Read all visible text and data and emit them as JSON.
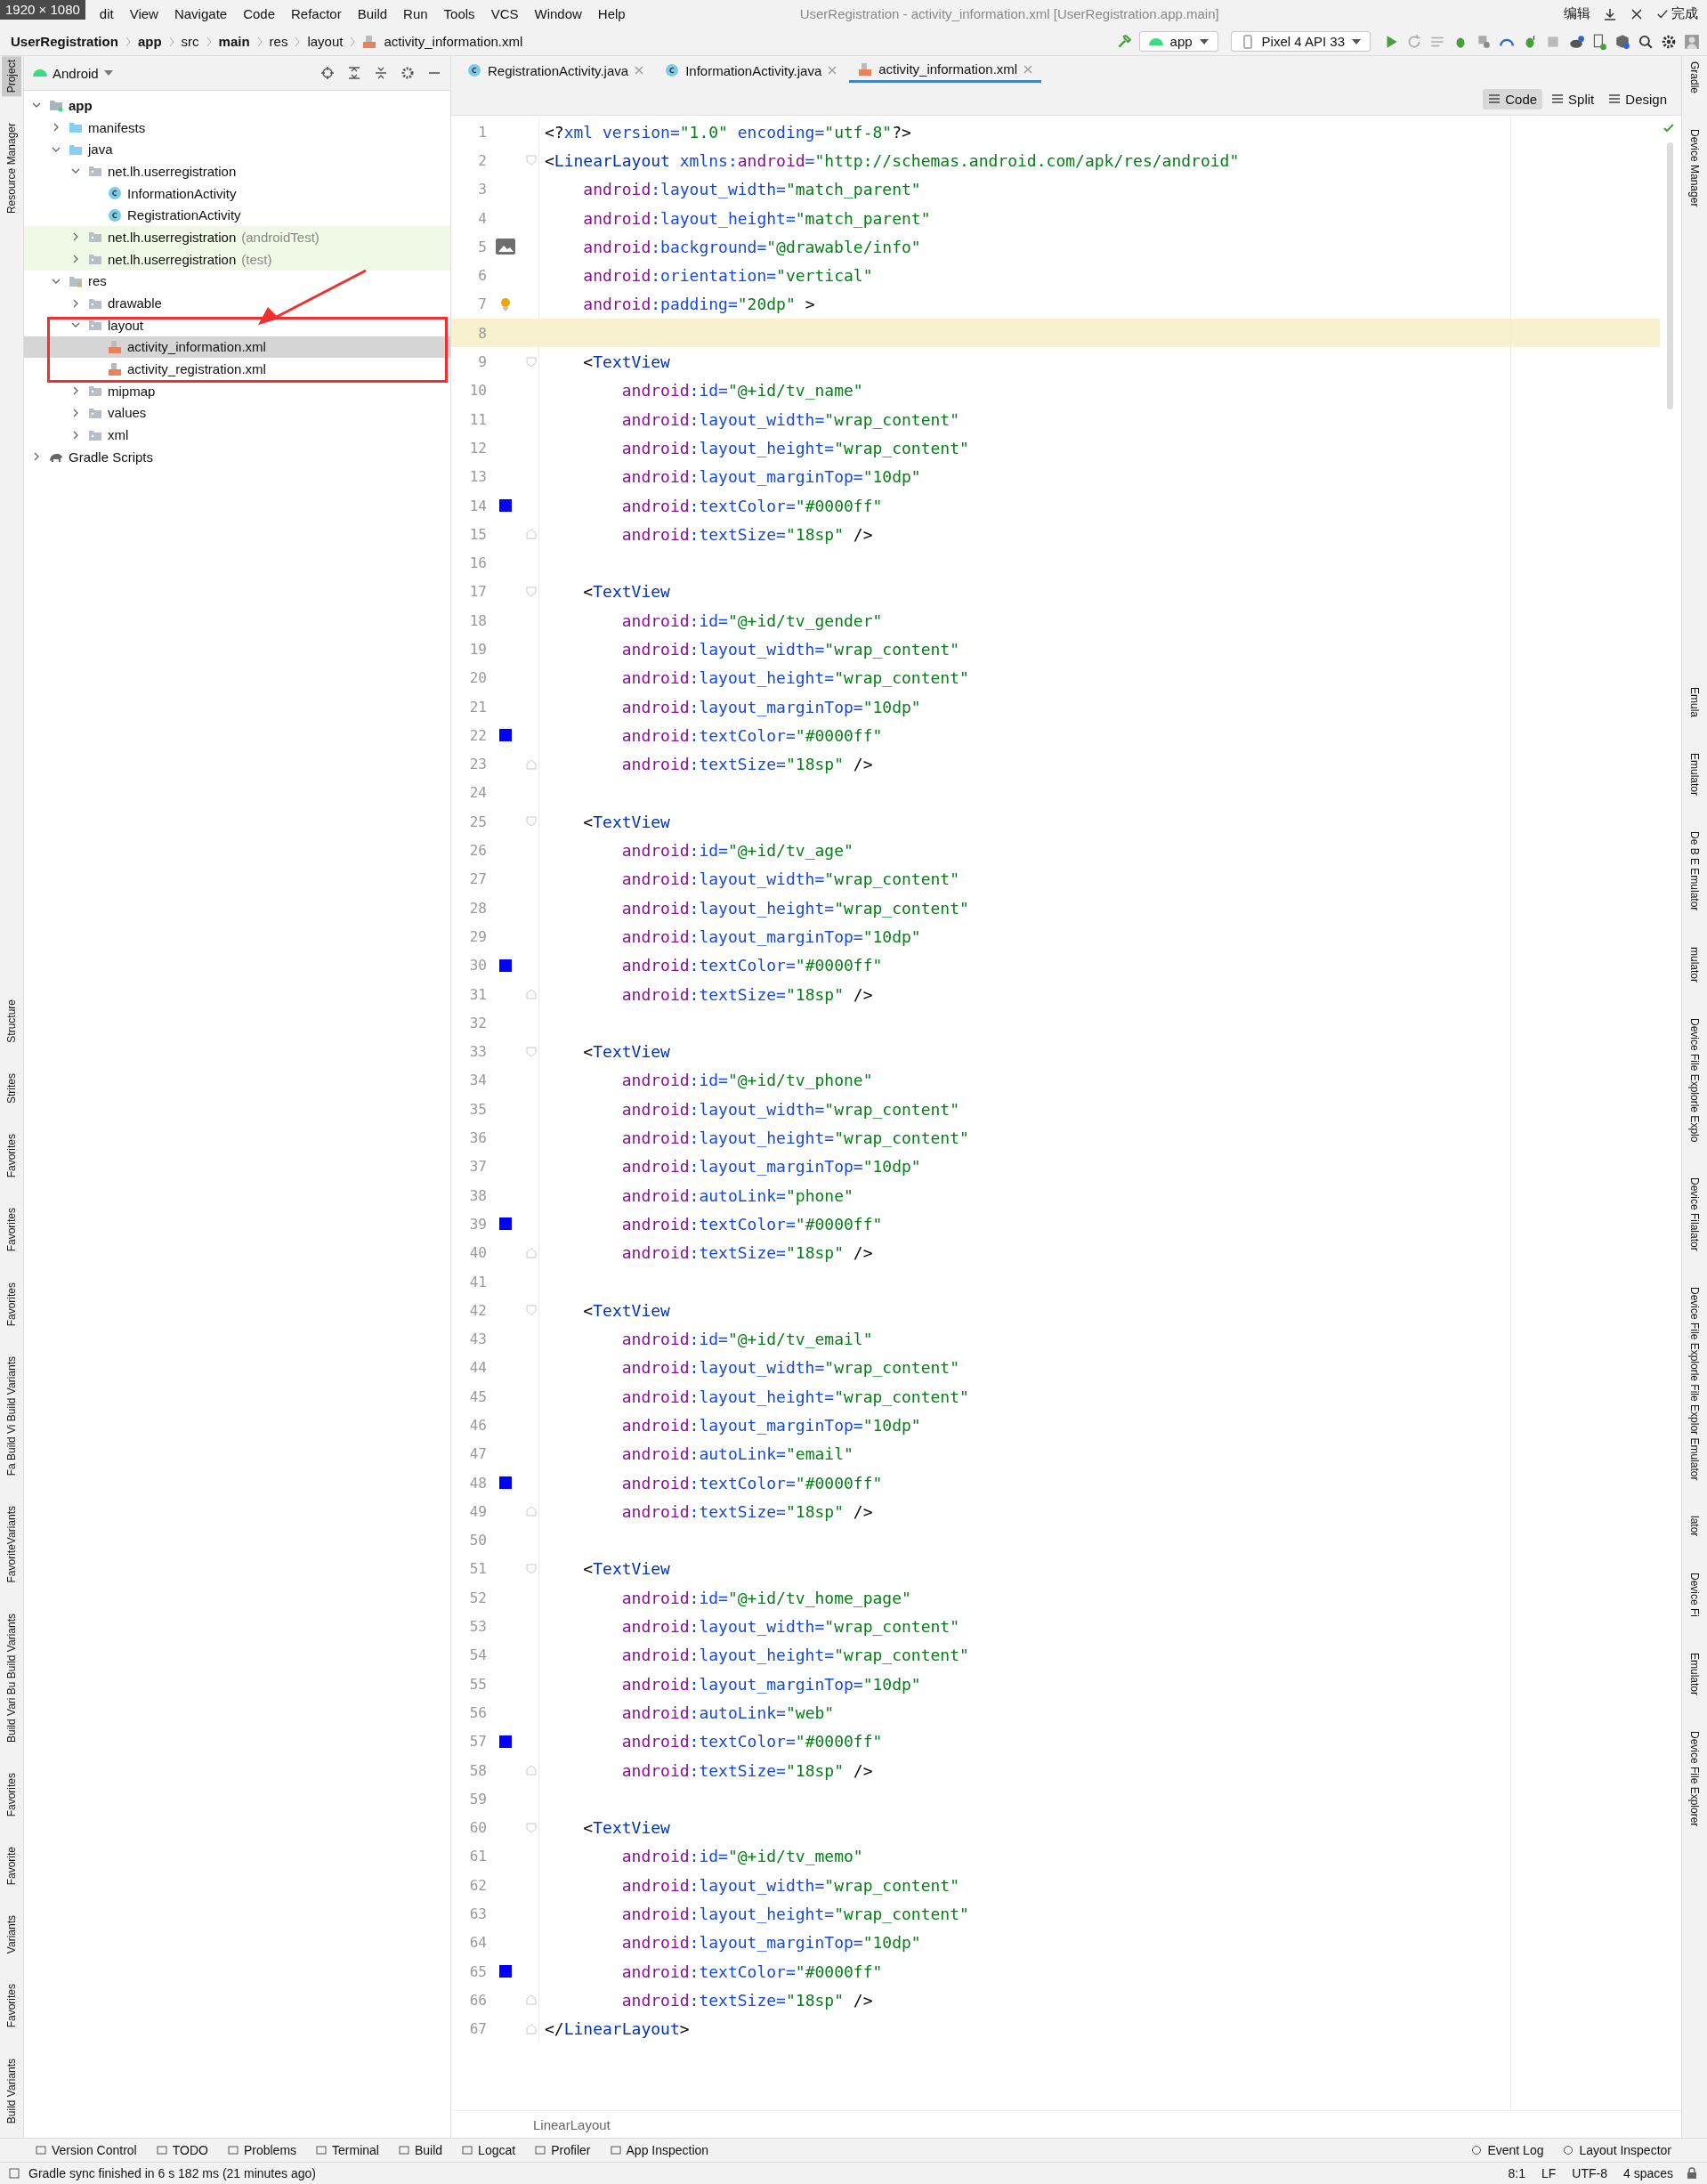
{
  "screen_badge": "1920 × 1080",
  "menu": [
    "dit",
    "View",
    "Navigate",
    "Code",
    "Refactor",
    "Build",
    "Run",
    "Tools",
    "VCS",
    "Window",
    "Help"
  ],
  "window": {
    "title": "UserRegistration - activity_information.xml [UserRegistration.app.main]",
    "ime_label": "编辑",
    "done_label": "完成"
  },
  "breadcrumbs": [
    {
      "label": "UserRegistration",
      "bold": true,
      "kind": "text"
    },
    {
      "label": "app",
      "bold": true,
      "kind": "text"
    },
    {
      "label": "src",
      "bold": false,
      "kind": "text"
    },
    {
      "label": "main",
      "bold": true,
      "kind": "text"
    },
    {
      "label": "res",
      "bold": false,
      "kind": "text"
    },
    {
      "label": "layout",
      "bold": false,
      "kind": "text"
    },
    {
      "label": "activity_information.xml",
      "bold": false,
      "kind": "xml"
    }
  ],
  "run_config": "app",
  "device": "Pixel 4 API 33",
  "left_strip": [
    {
      "label": "Project",
      "selected": true
    },
    {
      "label": "Resource Manager",
      "selected": false
    },
    {
      "label": "Structure",
      "selected": false
    },
    {
      "label": "Strites",
      "selected": false
    },
    {
      "label": "Favorites",
      "selected": false
    },
    {
      "label": "Favorites",
      "selected": false
    },
    {
      "label": "Favorites",
      "selected": false
    },
    {
      "label": "Fa Build Vi Build Variants",
      "selected": false
    },
    {
      "label": "FavoriteVariants",
      "selected": false
    },
    {
      "label": "Build Vari Bu Build Variants",
      "selected": false
    },
    {
      "label": "Favorites",
      "selected": false
    },
    {
      "label": "Favorite",
      "selected": false
    },
    {
      "label": "Variants",
      "selected": false
    },
    {
      "label": "Favorites",
      "selected": false
    },
    {
      "label": "Build Variants",
      "selected": false
    }
  ],
  "right_strip": [
    "Gradle",
    "Device Manager",
    "Emula",
    "Emulator",
    "De B E Emulator",
    "mulator",
    "Device File Explorle Explo",
    "Device Filalator",
    "Device File Explorle File Explor Emulator",
    "lator",
    "Device Fi",
    "Emulator",
    "Device File Explorer"
  ],
  "project": {
    "view": "Android",
    "tree": [
      {
        "label": "app",
        "kind": "module",
        "expanded": true,
        "selected": false,
        "children": [
          {
            "label": "manifests",
            "kind": "folder",
            "expanded": false,
            "selected": false
          },
          {
            "label": "java",
            "kind": "folder",
            "expanded": true,
            "selected": false,
            "children": [
              {
                "label": "net.lh.userregistration",
                "kind": "package",
                "expanded": true,
                "selected": false,
                "children": [
                  {
                    "label": "InformationActivity",
                    "kind": "class",
                    "selected": false
                  },
                  {
                    "label": "RegistrationActivity",
                    "kind": "class",
                    "selected": false
                  }
                ]
              },
              {
                "label": "net.lh.userregistration",
                "suffix": "(androidTest)",
                "kind": "test-package",
                "expanded": false,
                "selected": false
              },
              {
                "label": "net.lh.userregistration",
                "suffix": "(test)",
                "kind": "test-package",
                "expanded": false,
                "selected": false
              }
            ]
          },
          {
            "label": "res",
            "kind": "res",
            "expanded": true,
            "selected": false,
            "children": [
              {
                "label": "drawable",
                "kind": "package",
                "expanded": false,
                "selected": false
              },
              {
                "label": "layout",
                "kind": "package",
                "expanded": true,
                "selected": false,
                "children": [
                  {
                    "label": "activity_information.xml",
                    "kind": "xml",
                    "selected": true
                  },
                  {
                    "label": "activity_registration.xml",
                    "kind": "xml",
                    "selected": false
                  }
                ]
              },
              {
                "label": "mipmap",
                "kind": "package",
                "expanded": false,
                "selected": false
              },
              {
                "label": "values",
                "kind": "package",
                "expanded": false,
                "selected": false
              },
              {
                "label": "xml",
                "kind": "package",
                "expanded": false,
                "selected": false
              }
            ]
          }
        ]
      },
      {
        "label": "Gradle Scripts",
        "kind": "gradle",
        "expanded": false,
        "selected": false
      }
    ]
  },
  "editor": {
    "tabs": [
      {
        "label": "RegistrationActivity.java",
        "kind": "java",
        "selected": false
      },
      {
        "label": "InformationActivity.java",
        "kind": "java",
        "selected": false
      },
      {
        "label": "activity_information.xml",
        "kind": "xml",
        "selected": true
      }
    ],
    "modes": [
      {
        "label": "Code",
        "selected": true
      },
      {
        "label": "Split",
        "selected": false
      },
      {
        "label": "Design",
        "selected": false
      }
    ],
    "lines": [
      {
        "number": "1",
        "kind": "root",
        "current": false,
        "tokens": [
          {
            "kind": "p",
            "text": "<?"
          },
          {
            "kind": "at",
            "text": "xml version="
          },
          {
            "kind": "str",
            "text": "\"1.0\""
          },
          {
            "kind": "at",
            "text": " encoding="
          },
          {
            "kind": "str",
            "text": "\"utf-8\""
          },
          {
            "kind": "p",
            "text": "?>"
          }
        ]
      },
      {
        "number": "2",
        "kind": "root",
        "current": false,
        "fold": {
          "kind": "open"
        },
        "tokens": [
          {
            "kind": "p",
            "text": "<"
          },
          {
            "kind": "tag",
            "text": "LinearLayout"
          },
          {
            "kind": "at",
            "text": " xmlns:"
          },
          {
            "kind": "ns",
            "text": "android"
          },
          {
            "kind": "at",
            "text": "="
          },
          {
            "kind": "str",
            "text": "\"http://schemas.android.com/apk/res/android\""
          }
        ]
      },
      {
        "number": "3",
        "kind": "attr",
        "current": false,
        "tokens": [
          {
            "kind": "ns",
            "text": "android"
          },
          {
            "kind": "at",
            "text": ":layout_width="
          },
          {
            "kind": "str",
            "text": "\"match_parent\""
          }
        ]
      },
      {
        "number": "4",
        "kind": "attr",
        "current": false,
        "tokens": [
          {
            "kind": "ns",
            "text": "android"
          },
          {
            "kind": "at",
            "text": ":layout_height="
          },
          {
            "kind": "str",
            "text": "\"match_parent\""
          }
        ]
      },
      {
        "number": "5",
        "kind": "attr",
        "current": false,
        "marker": {
          "kind": "image"
        },
        "tokens": [
          {
            "kind": "ns",
            "text": "android"
          },
          {
            "kind": "at",
            "text": ":background="
          },
          {
            "kind": "str",
            "text": "\"@drawable/info\""
          }
        ]
      },
      {
        "number": "6",
        "kind": "attr",
        "current": false,
        "tokens": [
          {
            "kind": "ns",
            "text": "android"
          },
          {
            "kind": "at",
            "text": ":orientation="
          },
          {
            "kind": "str",
            "text": "\"vertical\""
          }
        ]
      },
      {
        "number": "7",
        "kind": "attr",
        "current": false,
        "marker": {
          "kind": "bulb"
        },
        "tokens": [
          {
            "kind": "ns",
            "text": "android"
          },
          {
            "kind": "at",
            "text": ":padding="
          },
          {
            "kind": "str",
            "text": "\"20dp\""
          },
          {
            "kind": "p",
            "text": " >"
          }
        ]
      },
      {
        "number": "8",
        "current": true
      },
      {
        "number": "9",
        "kind": "element",
        "current": false,
        "fold": {
          "kind": "open"
        },
        "tokens": [
          {
            "kind": "p",
            "text": "<"
          },
          {
            "kind": "tag",
            "text": "TextView"
          }
        ]
      },
      {
        "number": "10",
        "kind": "element-attr",
        "current": false,
        "tokens": [
          {
            "kind": "ns",
            "text": "android"
          },
          {
            "kind": "at",
            "text": ":id="
          },
          {
            "kind": "str",
            "text": "\"@+id/tv_name\""
          }
        ]
      },
      {
        "number": "11",
        "kind": "element-attr",
        "current": false,
        "tokens": [
          {
            "kind": "ns",
            "text": "android"
          },
          {
            "kind": "at",
            "text": ":layout_width="
          },
          {
            "kind": "str",
            "text": "\"wrap_content\""
          }
        ]
      },
      {
        "number": "12",
        "kind": "element-attr",
        "current": false,
        "tokens": [
          {
            "kind": "ns",
            "text": "android"
          },
          {
            "kind": "at",
            "text": ":layout_height="
          },
          {
            "kind": "str",
            "text": "\"wrap_content\""
          }
        ]
      },
      {
        "number": "13",
        "kind": "element-attr",
        "current": false,
        "tokens": [
          {
            "kind": "ns",
            "text": "android"
          },
          {
            "kind": "at",
            "text": ":layout_marginTop="
          },
          {
            "kind": "str",
            "text": "\"10dp\""
          }
        ]
      },
      {
        "number": "14",
        "kind": "element-attr",
        "current": false,
        "marker": {
          "kind": "color",
          "color": "#0000ff"
        },
        "tokens": [
          {
            "kind": "ns",
            "text": "android"
          },
          {
            "kind": "at",
            "text": ":textColor="
          },
          {
            "kind": "str",
            "text": "\"#0000ff\""
          }
        ]
      },
      {
        "number": "15",
        "kind": "element-attr",
        "current": false,
        "fold": {
          "kind": "close"
        },
        "tokens": [
          {
            "kind": "ns",
            "text": "android"
          },
          {
            "kind": "at",
            "text": ":textSize="
          },
          {
            "kind": "str",
            "text": "\"18sp\""
          },
          {
            "kind": "p",
            "text": " />"
          }
        ]
      },
      {
        "number": "16",
        "current": false
      },
      {
        "number": "17",
        "kind": "element",
        "current": false,
        "fold": {
          "kind": "open"
        },
        "tokens": [
          {
            "kind": "p",
            "text": "<"
          },
          {
            "kind": "tag",
            "text": "TextView"
          }
        ]
      },
      {
        "number": "18",
        "kind": "element-attr",
        "current": false,
        "tokens": [
          {
            "kind": "ns",
            "text": "android"
          },
          {
            "kind": "at",
            "text": ":id="
          },
          {
            "kind": "str",
            "text": "\"@+id/tv_gender\""
          }
        ]
      },
      {
        "number": "19",
        "kind": "element-attr",
        "current": false,
        "tokens": [
          {
            "kind": "ns",
            "text": "android"
          },
          {
            "kind": "at",
            "text": ":layout_width="
          },
          {
            "kind": "str",
            "text": "\"wrap_content\""
          }
        ]
      },
      {
        "number": "20",
        "kind": "element-attr",
        "current": false,
        "tokens": [
          {
            "kind": "ns",
            "text": "android"
          },
          {
            "kind": "at",
            "text": ":layout_height="
          },
          {
            "kind": "str",
            "text": "\"wrap_content\""
          }
        ]
      },
      {
        "number": "21",
        "kind": "element-attr",
        "current": false,
        "tokens": [
          {
            "kind": "ns",
            "text": "android"
          },
          {
            "kind": "at",
            "text": ":layout_marginTop="
          },
          {
            "kind": "str",
            "text": "\"10dp\""
          }
        ]
      },
      {
        "number": "22",
        "kind": "element-attr",
        "current": false,
        "marker": {
          "kind": "color",
          "color": "#0000ff"
        },
        "tokens": [
          {
            "kind": "ns",
            "text": "android"
          },
          {
            "kind": "at",
            "text": ":textColor="
          },
          {
            "kind": "str",
            "text": "\"#0000ff\""
          }
        ]
      },
      {
        "number": "23",
        "kind": "element-attr",
        "current": false,
        "fold": {
          "kind": "close"
        },
        "tokens": [
          {
            "kind": "ns",
            "text": "android"
          },
          {
            "kind": "at",
            "text": ":textSize="
          },
          {
            "kind": "str",
            "text": "\"18sp\""
          },
          {
            "kind": "p",
            "text": " />"
          }
        ]
      },
      {
        "number": "24",
        "current": false
      },
      {
        "number": "25",
        "kind": "element",
        "current": false,
        "fold": {
          "kind": "open"
        },
        "tokens": [
          {
            "kind": "p",
            "text": "<"
          },
          {
            "kind": "tag",
            "text": "TextView"
          }
        ]
      },
      {
        "number": "26",
        "kind": "element-attr",
        "current": false,
        "tokens": [
          {
            "kind": "ns",
            "text": "android"
          },
          {
            "kind": "at",
            "text": ":id="
          },
          {
            "kind": "str",
            "text": "\"@+id/tv_age\""
          }
        ]
      },
      {
        "number": "27",
        "kind": "element-attr",
        "current": false,
        "tokens": [
          {
            "kind": "ns",
            "text": "android"
          },
          {
            "kind": "at",
            "text": ":layout_width="
          },
          {
            "kind": "str",
            "text": "\"wrap_content\""
          }
        ]
      },
      {
        "number": "28",
        "kind": "element-attr",
        "current": false,
        "tokens": [
          {
            "kind": "ns",
            "text": "android"
          },
          {
            "kind": "at",
            "text": ":layout_height="
          },
          {
            "kind": "str",
            "text": "\"wrap_content\""
          }
        ]
      },
      {
        "number": "29",
        "kind": "element-attr",
        "current": false,
        "tokens": [
          {
            "kind": "ns",
            "text": "android"
          },
          {
            "kind": "at",
            "text": ":layout_marginTop="
          },
          {
            "kind": "str",
            "text": "\"10dp\""
          }
        ]
      },
      {
        "number": "30",
        "kind": "element-attr",
        "current": false,
        "marker": {
          "kind": "color",
          "color": "#0000ff"
        },
        "tokens": [
          {
            "kind": "ns",
            "text": "android"
          },
          {
            "kind": "at",
            "text": ":textColor="
          },
          {
            "kind": "str",
            "text": "\"#0000ff\""
          }
        ]
      },
      {
        "number": "31",
        "kind": "element-attr",
        "current": false,
        "fold": {
          "kind": "close"
        },
        "tokens": [
          {
            "kind": "ns",
            "text": "android"
          },
          {
            "kind": "at",
            "text": ":textSize="
          },
          {
            "kind": "str",
            "text": "\"18sp\""
          },
          {
            "kind": "p",
            "text": " />"
          }
        ]
      },
      {
        "number": "32",
        "current": false
      },
      {
        "number": "33",
        "kind": "element",
        "current": false,
        "fold": {
          "kind": "open"
        },
        "tokens": [
          {
            "kind": "p",
            "text": "<"
          },
          {
            "kind": "tag",
            "text": "TextView"
          }
        ]
      },
      {
        "number": "34",
        "kind": "element-attr",
        "current": false,
        "tokens": [
          {
            "kind": "ns",
            "text": "android"
          },
          {
            "kind": "at",
            "text": ":id="
          },
          {
            "kind": "str",
            "text": "\"@+id/tv_phone\""
          }
        ]
      },
      {
        "number": "35",
        "kind": "element-attr",
        "current": false,
        "tokens": [
          {
            "kind": "ns",
            "text": "android"
          },
          {
            "kind": "at",
            "text": ":layout_width="
          },
          {
            "kind": "str",
            "text": "\"wrap_content\""
          }
        ]
      },
      {
        "number": "36",
        "kind": "element-attr",
        "current": false,
        "tokens": [
          {
            "kind": "ns",
            "text": "android"
          },
          {
            "kind": "at",
            "text": ":layout_height="
          },
          {
            "kind": "str",
            "text": "\"wrap_content\""
          }
        ]
      },
      {
        "number": "37",
        "kind": "element-attr",
        "current": false,
        "tokens": [
          {
            "kind": "ns",
            "text": "android"
          },
          {
            "kind": "at",
            "text": ":layout_marginTop="
          },
          {
            "kind": "str",
            "text": "\"10dp\""
          }
        ]
      },
      {
        "number": "38",
        "kind": "element-attr",
        "current": false,
        "tokens": [
          {
            "kind": "ns",
            "text": "android"
          },
          {
            "kind": "at",
            "text": ":autoLink="
          },
          {
            "kind": "str",
            "text": "\"phone\""
          }
        ]
      },
      {
        "number": "39",
        "kind": "element-attr",
        "current": false,
        "marker": {
          "kind": "color",
          "color": "#0000ff"
        },
        "tokens": [
          {
            "kind": "ns",
            "text": "android"
          },
          {
            "kind": "at",
            "text": ":textColor="
          },
          {
            "kind": "str",
            "text": "\"#0000ff\""
          }
        ]
      },
      {
        "number": "40",
        "kind": "element-attr",
        "current": false,
        "fold": {
          "kind": "close"
        },
        "tokens": [
          {
            "kind": "ns",
            "text": "android"
          },
          {
            "kind": "at",
            "text": ":textSize="
          },
          {
            "kind": "str",
            "text": "\"18sp\""
          },
          {
            "kind": "p",
            "text": " />"
          }
        ]
      },
      {
        "number": "41",
        "current": false
      },
      {
        "number": "42",
        "kind": "element",
        "current": false,
        "fold": {
          "kind": "open"
        },
        "tokens": [
          {
            "kind": "p",
            "text": "<"
          },
          {
            "kind": "tag",
            "text": "TextView"
          }
        ]
      },
      {
        "number": "43",
        "kind": "element-attr",
        "current": false,
        "tokens": [
          {
            "kind": "ns",
            "text": "android"
          },
          {
            "kind": "at",
            "text": ":id="
          },
          {
            "kind": "str",
            "text": "\"@+id/tv_email\""
          }
        ]
      },
      {
        "number": "44",
        "kind": "element-attr",
        "current": false,
        "tokens": [
          {
            "kind": "ns",
            "text": "android"
          },
          {
            "kind": "at",
            "text": ":layout_width="
          },
          {
            "kind": "str",
            "text": "\"wrap_content\""
          }
        ]
      },
      {
        "number": "45",
        "kind": "element-attr",
        "current": false,
        "tokens": [
          {
            "kind": "ns",
            "text": "android"
          },
          {
            "kind": "at",
            "text": ":layout_height="
          },
          {
            "kind": "str",
            "text": "\"wrap_content\""
          }
        ]
      },
      {
        "number": "46",
        "kind": "element-attr",
        "current": false,
        "tokens": [
          {
            "kind": "ns",
            "text": "android"
          },
          {
            "kind": "at",
            "text": ":layout_marginTop="
          },
          {
            "kind": "str",
            "text": "\"10dp\""
          }
        ]
      },
      {
        "number": "47",
        "kind": "element-attr",
        "current": false,
        "tokens": [
          {
            "kind": "ns",
            "text": "android"
          },
          {
            "kind": "at",
            "text": ":autoLink="
          },
          {
            "kind": "str",
            "text": "\"email\""
          }
        ]
      },
      {
        "number": "48",
        "kind": "element-attr",
        "current": false,
        "marker": {
          "kind": "color",
          "color": "#0000ff"
        },
        "tokens": [
          {
            "kind": "ns",
            "text": "android"
          },
          {
            "kind": "at",
            "text": ":textColor="
          },
          {
            "kind": "str",
            "text": "\"#0000ff\""
          }
        ]
      },
      {
        "number": "49",
        "kind": "element-attr",
        "current": false,
        "fold": {
          "kind": "close"
        },
        "tokens": [
          {
            "kind": "ns",
            "text": "android"
          },
          {
            "kind": "at",
            "text": ":textSize="
          },
          {
            "kind": "str",
            "text": "\"18sp\""
          },
          {
            "kind": "p",
            "text": " />"
          }
        ]
      },
      {
        "number": "50",
        "current": false
      },
      {
        "number": "51",
        "kind": "element",
        "current": false,
        "fold": {
          "kind": "open"
        },
        "tokens": [
          {
            "kind": "p",
            "text": "<"
          },
          {
            "kind": "tag",
            "text": "TextView"
          }
        ]
      },
      {
        "number": "52",
        "kind": "element-attr",
        "current": false,
        "tokens": [
          {
            "kind": "ns",
            "text": "android"
          },
          {
            "kind": "at",
            "text": ":id="
          },
          {
            "kind": "str",
            "text": "\"@+id/tv_home_page\""
          }
        ]
      },
      {
        "number": "53",
        "kind": "element-attr",
        "current": false,
        "tokens": [
          {
            "kind": "ns",
            "text": "android"
          },
          {
            "kind": "at",
            "text": ":layout_width="
          },
          {
            "kind": "str",
            "text": "\"wrap_content\""
          }
        ]
      },
      {
        "number": "54",
        "kind": "element-attr",
        "current": false,
        "tokens": [
          {
            "kind": "ns",
            "text": "android"
          },
          {
            "kind": "at",
            "text": ":layout_height="
          },
          {
            "kind": "str",
            "text": "\"wrap_content\""
          }
        ]
      },
      {
        "number": "55",
        "kind": "element-attr",
        "current": false,
        "tokens": [
          {
            "kind": "ns",
            "text": "android"
          },
          {
            "kind": "at",
            "text": ":layout_marginTop="
          },
          {
            "kind": "str",
            "text": "\"10dp\""
          }
        ]
      },
      {
        "number": "56",
        "kind": "element-attr",
        "current": false,
        "tokens": [
          {
            "kind": "ns",
            "text": "android"
          },
          {
            "kind": "at",
            "text": ":autoLink="
          },
          {
            "kind": "str",
            "text": "\"web\""
          }
        ]
      },
      {
        "number": "57",
        "kind": "element-attr",
        "current": false,
        "marker": {
          "kind": "color",
          "color": "#0000ff"
        },
        "tokens": [
          {
            "kind": "ns",
            "text": "android"
          },
          {
            "kind": "at",
            "text": ":textColor="
          },
          {
            "kind": "str",
            "text": "\"#0000ff\""
          }
        ]
      },
      {
        "number": "58",
        "kind": "element-attr",
        "current": false,
        "fold": {
          "kind": "close"
        },
        "tokens": [
          {
            "kind": "ns",
            "text": "android"
          },
          {
            "kind": "at",
            "text": ":textSize="
          },
          {
            "kind": "str",
            "text": "\"18sp\""
          },
          {
            "kind": "p",
            "text": " />"
          }
        ]
      },
      {
        "number": "59",
        "current": false
      },
      {
        "number": "60",
        "kind": "element",
        "current": false,
        "fold": {
          "kind": "open"
        },
        "tokens": [
          {
            "kind": "p",
            "text": "<"
          },
          {
            "kind": "tag",
            "text": "TextView"
          }
        ]
      },
      {
        "number": "61",
        "kind": "element-attr",
        "current": false,
        "tokens": [
          {
            "kind": "ns",
            "text": "android"
          },
          {
            "kind": "at",
            "text": ":id="
          },
          {
            "kind": "str",
            "text": "\"@+id/tv_memo\""
          }
        ]
      },
      {
        "number": "62",
        "kind": "element-attr",
        "current": false,
        "tokens": [
          {
            "kind": "ns",
            "text": "android"
          },
          {
            "kind": "at",
            "text": ":layout_width="
          },
          {
            "kind": "str",
            "text": "\"wrap_content\""
          }
        ]
      },
      {
        "number": "63",
        "kind": "element-attr",
        "current": false,
        "tokens": [
          {
            "kind": "ns",
            "text": "android"
          },
          {
            "kind": "at",
            "text": ":layout_height="
          },
          {
            "kind": "str",
            "text": "\"wrap_content\""
          }
        ]
      },
      {
        "number": "64",
        "kind": "element-attr",
        "current": false,
        "tokens": [
          {
            "kind": "ns",
            "text": "android"
          },
          {
            "kind": "at",
            "text": ":layout_marginTop="
          },
          {
            "kind": "str",
            "text": "\"10dp\""
          }
        ]
      },
      {
        "number": "65",
        "kind": "element-attr",
        "current": false,
        "marker": {
          "kind": "color",
          "color": "#0000ff"
        },
        "tokens": [
          {
            "kind": "ns",
            "text": "android"
          },
          {
            "kind": "at",
            "text": ":textColor="
          },
          {
            "kind": "str",
            "text": "\"#0000ff\""
          }
        ]
      },
      {
        "number": "66",
        "kind": "element-attr",
        "current": false,
        "fold": {
          "kind": "close"
        },
        "tokens": [
          {
            "kind": "ns",
            "text": "android"
          },
          {
            "kind": "at",
            "text": ":textSize="
          },
          {
            "kind": "str",
            "text": "\"18sp\""
          },
          {
            "kind": "p",
            "text": " />"
          }
        ]
      },
      {
        "number": "67",
        "kind": "root",
        "current": false,
        "fold": {
          "kind": "close"
        },
        "tokens": [
          {
            "kind": "p",
            "text": "</"
          },
          {
            "kind": "tag",
            "text": "LinearLayout"
          },
          {
            "kind": "p",
            "text": ">"
          }
        ]
      }
    ],
    "structure_path": "LinearLayout"
  },
  "tool_windows": [
    "Version Control",
    "TODO",
    "Problems",
    "Terminal",
    "Build",
    "Logcat",
    "Profiler",
    "App Inspection"
  ],
  "tool_windows_right": [
    "Event Log",
    "Layout Inspector"
  ],
  "status_bar": {
    "message": "Gradle sync finished in 6 s 182 ms (21 minutes ago)",
    "items": [
      "8:1",
      "LF",
      "UTF-8",
      "4 spaces"
    ]
  }
}
